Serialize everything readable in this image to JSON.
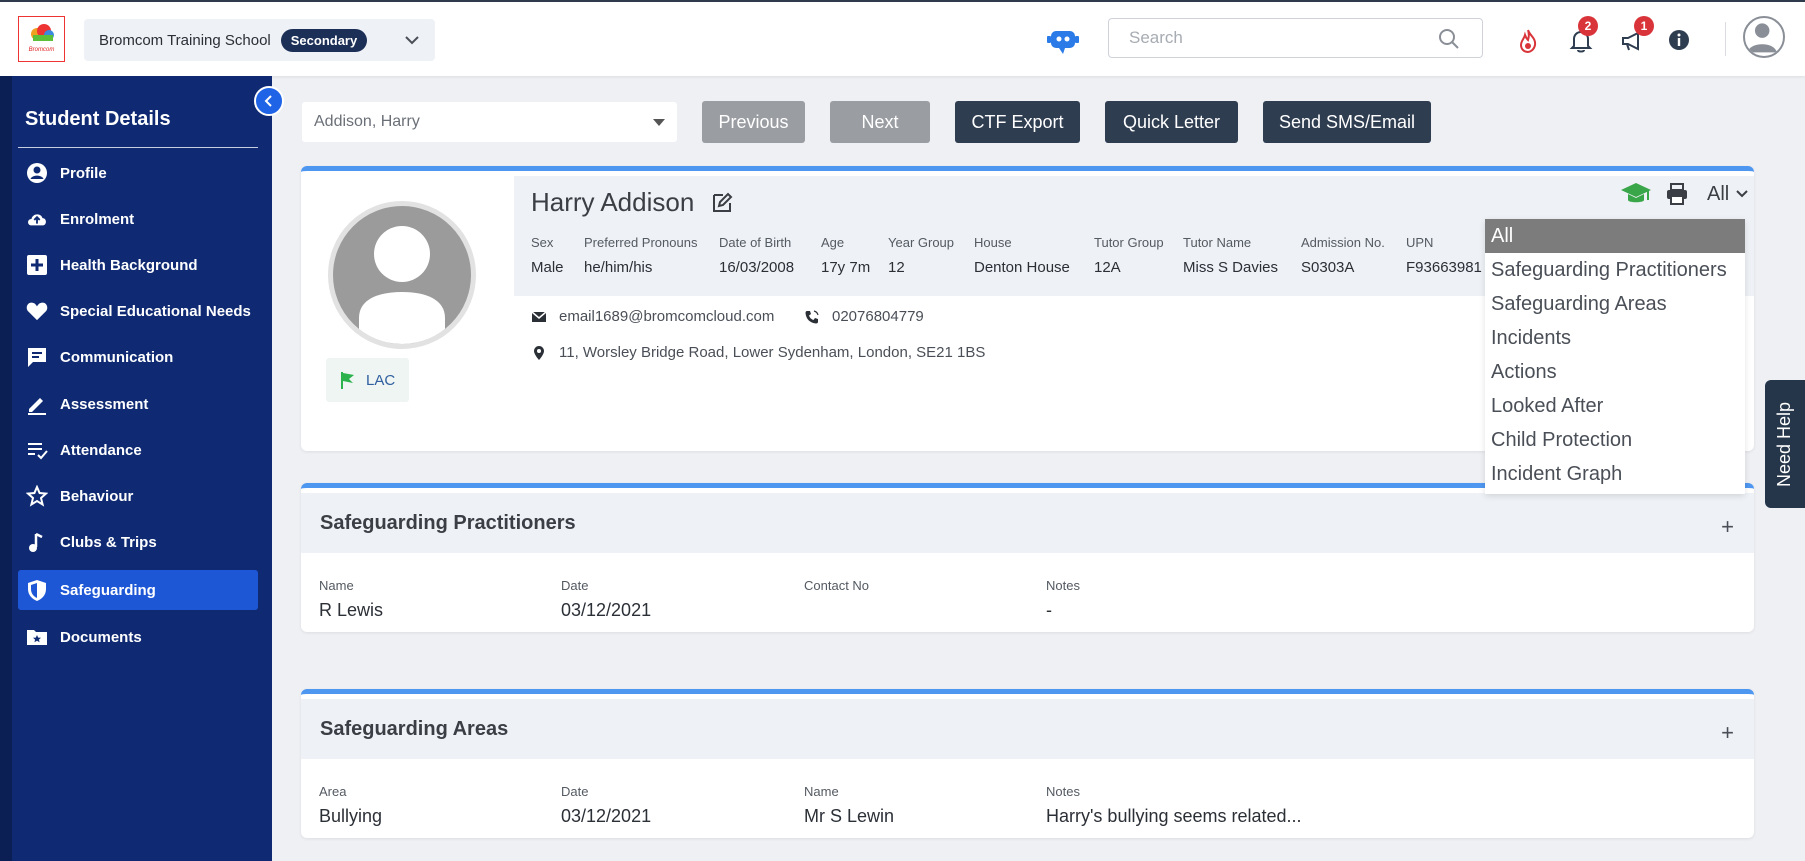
{
  "brand": {
    "logo_text": "Bromcom"
  },
  "header": {
    "school_name": "Bromcom Training School",
    "school_type": "Secondary",
    "search_placeholder": "Search",
    "notifications_count": "2",
    "announcements_count": "1"
  },
  "sidebar": {
    "title": "Student Details",
    "items": [
      {
        "label": "Profile",
        "icon": "user-circle-icon"
      },
      {
        "label": "Enrolment",
        "icon": "cloud-upload-icon"
      },
      {
        "label": "Health Background",
        "icon": "medical-cross-icon"
      },
      {
        "label": "Special Educational Needs",
        "icon": "heart-icon"
      },
      {
        "label": "Communication",
        "icon": "chat-icon"
      },
      {
        "label": "Assessment",
        "icon": "pencil-icon"
      },
      {
        "label": "Attendance",
        "icon": "checklist-icon"
      },
      {
        "label": "Behaviour",
        "icon": "star-icon"
      },
      {
        "label": "Clubs & Trips",
        "icon": "music-note-icon"
      },
      {
        "label": "Safeguarding",
        "icon": "shield-icon",
        "active": true
      },
      {
        "label": "Documents",
        "icon": "folder-star-icon"
      }
    ]
  },
  "toolbar": {
    "student_selected": "Addison, Harry",
    "previous_label": "Previous",
    "next_label": "Next",
    "ctf_export_label": "CTF Export",
    "quick_letter_label": "Quick Letter",
    "send_sms_label": "Send SMS/Email"
  },
  "student": {
    "name": "Harry Addison",
    "fields": [
      {
        "label": "Sex",
        "value": "Male"
      },
      {
        "label": "Preferred Pronouns",
        "value": "he/him/his"
      },
      {
        "label": "Date of Birth",
        "value": "16/03/2008"
      },
      {
        "label": "Age",
        "value": "17y 7m"
      },
      {
        "label": "Year Group",
        "value": "12"
      },
      {
        "label": "House",
        "value": "Denton House"
      },
      {
        "label": "Tutor Group",
        "value": "12A"
      },
      {
        "label": "Tutor Name",
        "value": "Miss S Davies"
      },
      {
        "label": "Admission No.",
        "value": "S0303A"
      },
      {
        "label": "UPN",
        "value": "F93663981"
      }
    ],
    "email": "email1689@bromcomcloud.com",
    "phone": "02076804779",
    "address": "11, Worsley Bridge Road, Lower Sydenham, London, SE21 1BS",
    "flag": "LAC",
    "view_filter": "All"
  },
  "filter_dropdown": {
    "options": [
      "All",
      "Safeguarding Practitioners",
      "Safeguarding Areas",
      "Incidents",
      "Actions",
      "Looked After",
      "Child Protection",
      "Incident Graph"
    ],
    "selected": "All"
  },
  "practitioners": {
    "title": "Safeguarding Practitioners",
    "columns": [
      "Name",
      "Date",
      "Contact No",
      "Notes"
    ],
    "rows": [
      [
        "R Lewis",
        "03/12/2021",
        "",
        "-"
      ]
    ]
  },
  "areas": {
    "title": "Safeguarding Areas",
    "columns": [
      "Area",
      "Date",
      "Name",
      "Notes"
    ],
    "rows": [
      [
        "Bullying",
        "03/12/2021",
        "Mr S Lewin",
        "Harry's bullying seems related..."
      ]
    ]
  },
  "help": {
    "label": "Need Help"
  },
  "colors": {
    "sidebar": "#0f2a72",
    "active": "#1e57d6",
    "accent": "#4e97f0",
    "dark_button": "#2f3d51",
    "grey_button": "#9a9da2",
    "badge": "#d9343a"
  }
}
